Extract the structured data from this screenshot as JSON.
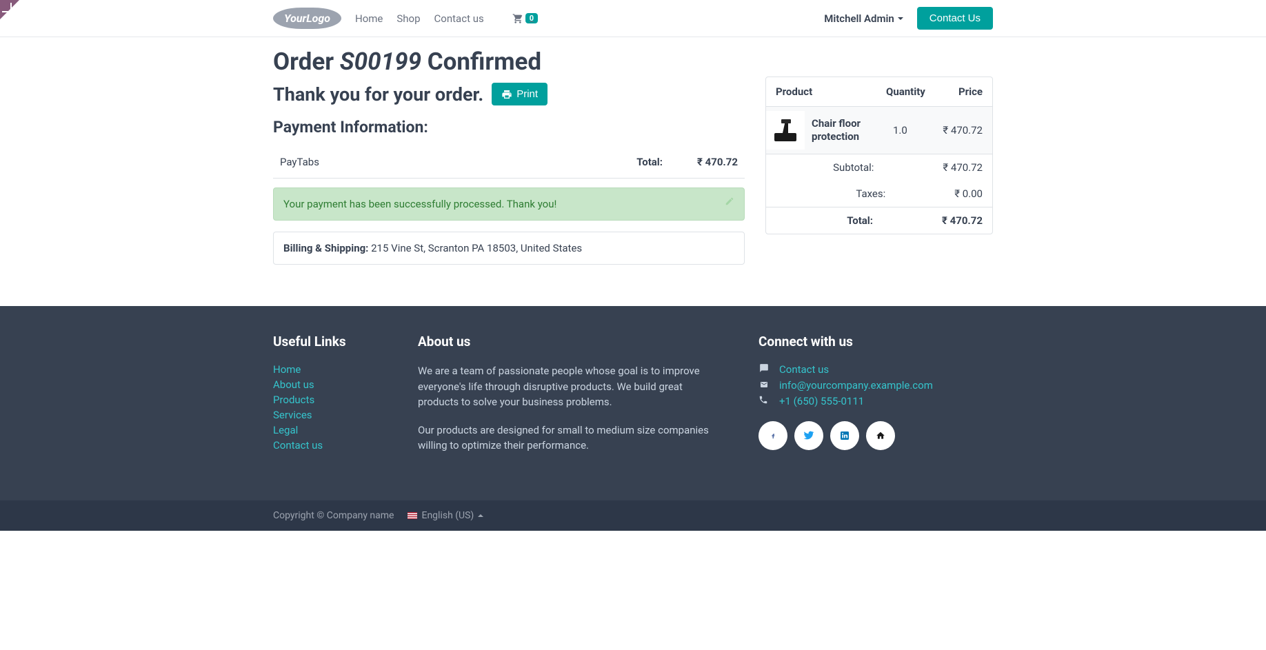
{
  "nav": {
    "logo_text": "YourLogo",
    "links": [
      "Home",
      "Shop",
      "Contact us"
    ],
    "cart_count": "0",
    "user_name": "Mitchell Admin",
    "contact_btn": "Contact Us"
  },
  "order": {
    "title_prefix": "Order ",
    "number": "S00199",
    "title_suffix": " Confirmed",
    "thank_you": "Thank you for your order.",
    "print_label": "Print",
    "payment_heading": "Payment Information:",
    "payment_method": "PayTabs",
    "total_label": "Total:",
    "total_value": "₹ 470.72",
    "success_msg": "Your payment has been successfully processed. Thank you!",
    "billing_label": "Billing & Shipping:",
    "billing_address": " 215 Vine St, Scranton PA 18503, United States"
  },
  "summary": {
    "col_product": "Product",
    "col_quantity": "Quantity",
    "col_price": "Price",
    "item_name": "Chair floor protection",
    "item_qty": "1.0",
    "item_price": "₹ 470.72",
    "subtotal_label": "Subtotal:",
    "subtotal_value": "₹ 470.72",
    "taxes_label": "Taxes:",
    "taxes_value": "₹ 0.00",
    "total_label": "Total:",
    "total_value": "₹ 470.72"
  },
  "footer": {
    "useful_heading": "Useful Links",
    "useful_links": [
      "Home",
      "About us",
      "Products",
      "Services",
      "Legal",
      "Contact us"
    ],
    "about_heading": "About us",
    "about_p1": "We are a team of passionate people whose goal is to improve everyone's life through disruptive products. We build great products to solve your business problems.",
    "about_p2": "Our products are designed for small to medium size companies willing to optimize their performance.",
    "connect_heading": "Connect with us",
    "contact_link": "Contact us",
    "email": "info@yourcompany.example.com",
    "phone": "+1 (650) 555-0111",
    "copyright": "Copyright © Company name",
    "language": "English (US)"
  }
}
